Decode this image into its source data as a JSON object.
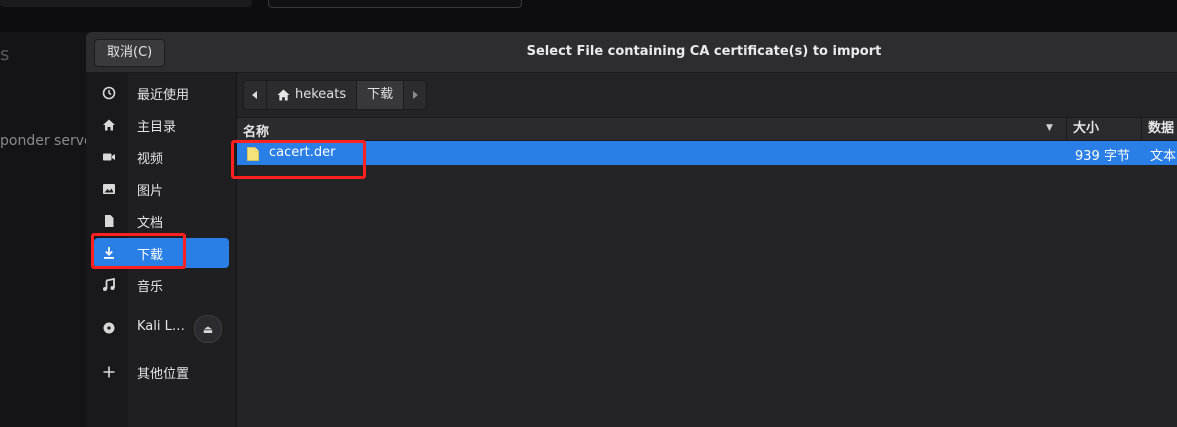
{
  "background": {
    "fragment_letter": "s",
    "fragment_text": "ponder serve"
  },
  "dialog": {
    "title": "Select File containing CA certificate(s) to import",
    "cancel_label": "取消(C)"
  },
  "sidebar": {
    "items": [
      {
        "label": "最近使用",
        "icon": "clock-icon"
      },
      {
        "label": "主目录",
        "icon": "home-icon"
      },
      {
        "label": "视频",
        "icon": "video-camera-icon"
      },
      {
        "label": "图片",
        "icon": "picture-icon"
      },
      {
        "label": "文档",
        "icon": "document-icon"
      },
      {
        "label": "下载",
        "icon": "download-icon",
        "active": true
      },
      {
        "label": "音乐",
        "icon": "music-note-icon"
      },
      {
        "label": "Kali L…",
        "icon": "disc-icon",
        "eject_icon": "eject-icon"
      },
      {
        "label": "其他位置",
        "icon": "plus-icon"
      }
    ]
  },
  "pathbar": {
    "segments": [
      "hekeats",
      "下载"
    ],
    "home_icon": "home-icon"
  },
  "columns": {
    "name": "名称",
    "size": "大小",
    "type": "数据"
  },
  "files": [
    {
      "name": "cacert.der",
      "size": "939 字节",
      "type": "文本"
    }
  ],
  "colors": {
    "accent": "#2a7fe6",
    "highlight": "#ff2020"
  }
}
